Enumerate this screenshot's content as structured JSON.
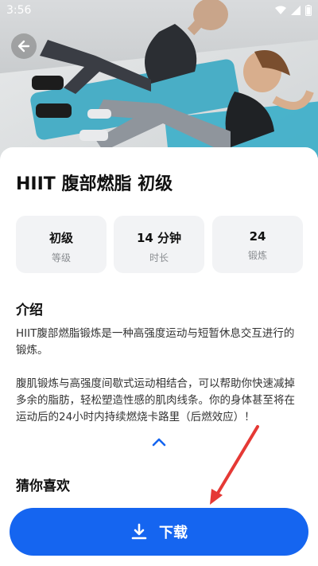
{
  "status_bar": {
    "time": "3:56"
  },
  "workout": {
    "title": "HIIT 腹部燃脂 初级",
    "stats": [
      {
        "value": "初级",
        "label": "等级"
      },
      {
        "value": "14 分钟",
        "label": "时长"
      },
      {
        "value": "24",
        "label": "锻炼"
      }
    ]
  },
  "intro": {
    "heading": "介绍",
    "para1": "HIIT腹部燃脂锻炼是一种高强度运动与短暂休息交互进行的锻炼。",
    "para2": "腹肌锻炼与高强度间歇式运动相结合，可以帮助你快速减掉多余的脂肪，轻松塑造性感的肌肉线条。你的身体甚至将在运动后的24小时内持续燃烧卡路里（后燃效应）！"
  },
  "recommend": {
    "heading": "猜你喜欢"
  },
  "download_button": {
    "label": "下载"
  },
  "colors": {
    "accent": "#1565f0",
    "annotation": "#e53935",
    "stat_bg": "#f2f3f5"
  }
}
